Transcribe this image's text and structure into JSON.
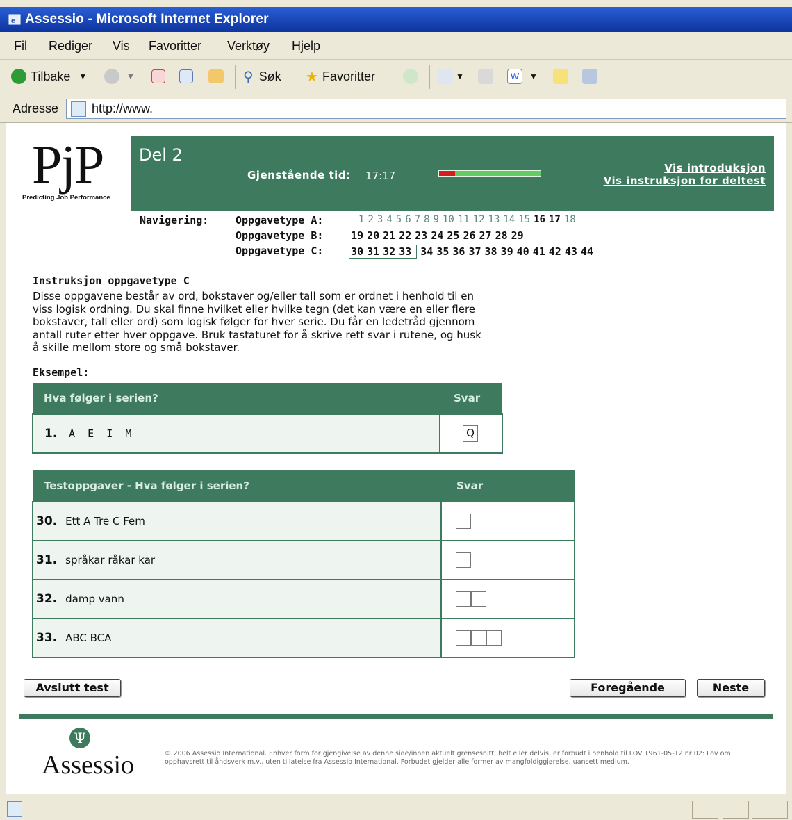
{
  "window": {
    "title": "Assessio - Microsoft Internet Explorer"
  },
  "menu": [
    "Fil",
    "Rediger",
    "Vis",
    "Favoritter",
    "Verktøy",
    "Hjelp"
  ],
  "toolbar": {
    "back": "Tilbake",
    "search": "Søk",
    "favorites": "Favoritter"
  },
  "address": {
    "label": "Adresse",
    "url": "http://www."
  },
  "brand": {
    "pjp_logo": "PjP",
    "pjp_tagline": "Predicting Job Performance",
    "assessio": "Assessio",
    "accent": "#3e7a5e"
  },
  "header": {
    "section": "Del 2",
    "time_label": "Gjenstående tid:",
    "time_value": "17:17",
    "time_remaining_fraction": 0.16,
    "link_intro": "Vis introduksjon",
    "link_instr": "Vis instruksjon for deltest"
  },
  "navigation": {
    "label": "Navigering:",
    "rows": [
      {
        "label": "Oppgavetype A:",
        "items": [
          "1",
          "2",
          "3",
          "4",
          "5",
          "6",
          "7",
          "8",
          "9",
          "10",
          "11",
          "12",
          "13",
          "14",
          "15",
          "16",
          "17",
          "18"
        ],
        "bold": [
          "16",
          "17"
        ]
      },
      {
        "label": "Oppgavetype B:",
        "items": [
          "19",
          "20",
          "21",
          "22",
          "23",
          "24",
          "25",
          "26",
          "27",
          "28",
          "29"
        ],
        "bold": "all"
      },
      {
        "label": "Oppgavetype C:",
        "items": [
          "30",
          "31",
          "32",
          "33",
          "34",
          "35",
          "36",
          "37",
          "38",
          "39",
          "40",
          "41",
          "42",
          "43",
          "44"
        ],
        "bold": "all",
        "current": [
          "30",
          "31",
          "32",
          "33"
        ]
      }
    ]
  },
  "instructions": {
    "heading": "Instruksjon oppgavetype C",
    "lines": [
      "Disse oppgavene består av ord, bokstaver og/eller tall som er ordnet i henhold til en",
      "viss logisk ordning. Du skal finne hvilket eller hvilke tegn (det kan være en eller flere",
      "bokstaver, tall eller ord) som logisk følger for hver serie. Du får en ledetråd gjennom",
      "antall ruter etter hver oppgave. Bruk tastaturet for å skrive rett svar i rutene, og husk",
      "å skille mellom store og små bokstaver."
    ]
  },
  "example": {
    "label": "Eksempel:",
    "header": "Hva følger i serien?",
    "answer_header": "Svar",
    "number": "1.",
    "series": "A  E  I  M",
    "answer": "Q"
  },
  "test": {
    "header": "Testoppgaver - Hva følger i serien?",
    "answer_header": "Svar",
    "items": [
      {
        "number": "30.",
        "text": "Ett A Tre C Fem",
        "boxes": 1
      },
      {
        "number": "31.",
        "text": "språkar råkar kar",
        "boxes": 1
      },
      {
        "number": "32.",
        "text": "damp vann",
        "boxes": 2
      },
      {
        "number": "33.",
        "text": "ABC BCA",
        "boxes": 3
      }
    ]
  },
  "buttons": {
    "end": "Avslutt test",
    "prev": "Foregående",
    "next": "Neste"
  },
  "footer": {
    "copyright": "© 2006 Assessio International. Enhver form for gjengivelse av denne side/innen aktuelt grensesnitt, helt eller delvis, er forbudt i henhold til LOV 1961-05-12 nr 02: Lov om opphavsrett til åndsverk m.v., uten tillatelse fra Assessio International. Forbudet gjelder alle former av mangfoldiggjørelse, uansett medium."
  }
}
